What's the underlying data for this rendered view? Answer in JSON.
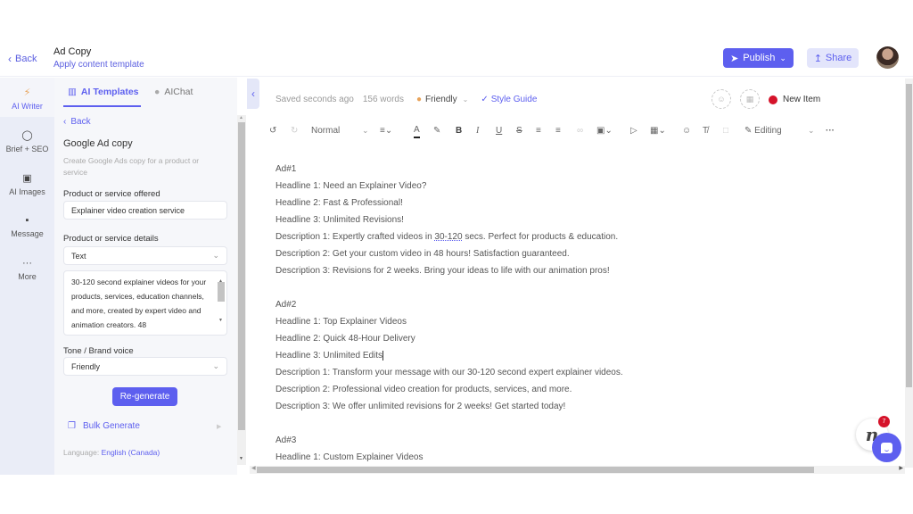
{
  "header": {
    "back_label": "Back",
    "title": "Ad Copy",
    "subtitle": "Apply content template",
    "publish_label": "Publish",
    "share_label": "Share"
  },
  "rail": {
    "items": [
      {
        "label": "AI Writer",
        "icon": "bolt-icon",
        "active": true
      },
      {
        "label": "Brief + SEO",
        "icon": "crosshair-icon"
      },
      {
        "label": "AI Images",
        "icon": "image-icon"
      },
      {
        "label": "Message",
        "icon": "message-icon"
      },
      {
        "label": "More",
        "icon": "ellipsis-icon"
      }
    ]
  },
  "panel": {
    "tabs": [
      {
        "label": "AI Templates",
        "active": true
      },
      {
        "label": "AIChat"
      }
    ],
    "back_label": "Back",
    "template_title": "Google Ad copy",
    "template_description": "Create Google Ads copy for a product or service",
    "product_label": "Product or service offered",
    "product_value": "Explainer video creation service",
    "details_label": "Product or service details",
    "details_type": "Text",
    "details_text": "30-120 second explainer videos for your products, services, education channels, and more, created by expert video and animation creators. 48",
    "tone_label": "Tone / Brand voice",
    "tone_value": "Friendly",
    "regenerate_label": "Re-generate",
    "bulk_label": "Bulk Generate",
    "language_label": "Language:",
    "language_value": "English (Canada)"
  },
  "editor": {
    "saved_status": "Saved seconds ago",
    "word_count": "156 words",
    "tone": "Friendly",
    "style_guide": "Style Guide",
    "new_item_label": "New Item",
    "toolbar": {
      "paragraph_style": "Normal",
      "mode": "Editing"
    },
    "ads": [
      {
        "title": "Ad#1",
        "lines": [
          "Headline 1: Need an Explainer Video?",
          "Headline 2: Fast & Professional!",
          "Headline 3: Unlimited Revisions!",
          "Description 1: Expertly crafted videos in 30-120 secs. Perfect for products & education.",
          "Description 2: Get your custom video in 48 hours! Satisfaction guaranteed.",
          "Description 3: Revisions for 2 weeks. Bring your ideas to life with our animation pros!"
        ]
      },
      {
        "title": "Ad#2",
        "lines": [
          "Headline 1: Top Explainer Videos",
          "Headline 2: Quick 48-Hour Delivery",
          "Headline 3: Unlimited Edits",
          "Description 1: Transform your message with our 30-120 second expert explainer videos.",
          "Description 2: Professional video creation for products, services, and more.",
          "Description 3: We offer unlimited revisions for 2 weeks! Get started today!"
        ]
      },
      {
        "title": "Ad#3",
        "lines": [
          "Headline 1: Custom Explainer Videos"
        ]
      }
    ]
  },
  "widgets": {
    "notification_count": "7",
    "brand_glyph": "n"
  },
  "colors": {
    "accent": "#5d5fef",
    "status_red": "#d5132a"
  }
}
